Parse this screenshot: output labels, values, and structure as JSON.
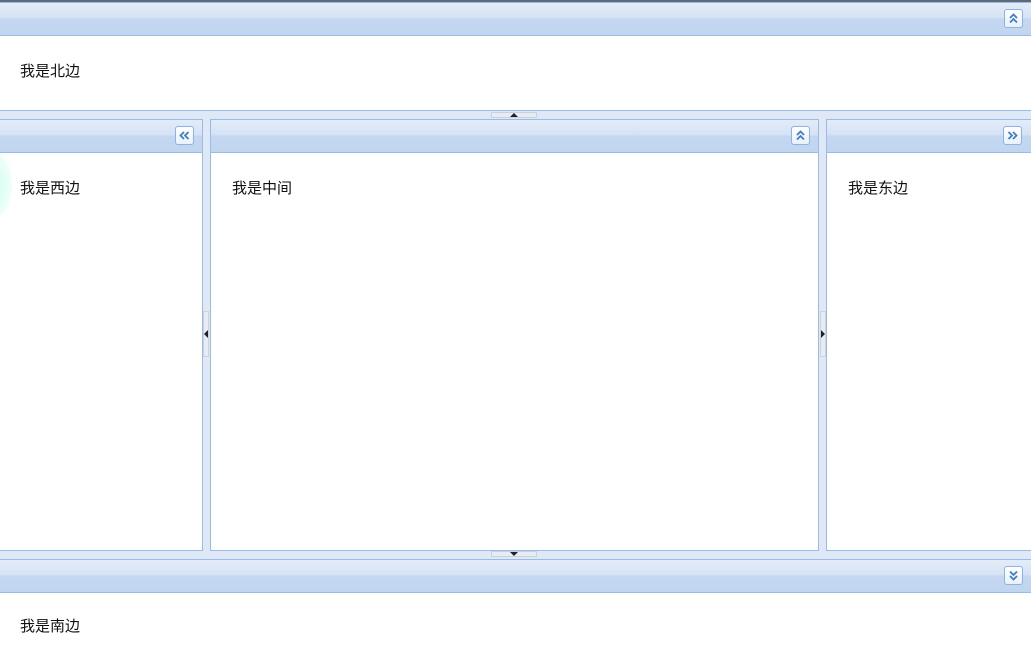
{
  "regions": {
    "north": {
      "text": "我是北边"
    },
    "west": {
      "text": "我是西边"
    },
    "center": {
      "text": "我是中间"
    },
    "east": {
      "text": "我是东边"
    },
    "south": {
      "text": "我是南边"
    }
  },
  "icons": {
    "north_tool": "double-chevron-up-icon",
    "west_tool": "double-chevron-left-icon",
    "center_tool": "double-chevron-up-icon",
    "east_tool": "double-chevron-right-icon",
    "south_tool": "double-chevron-down-icon"
  },
  "colors": {
    "border": "#99bbe8",
    "header_top": "#e3ecf8",
    "header_bottom": "#c2d5f0",
    "background": "#dfe8f6",
    "body": "#ffffff",
    "icon": "#3f7dc7"
  }
}
